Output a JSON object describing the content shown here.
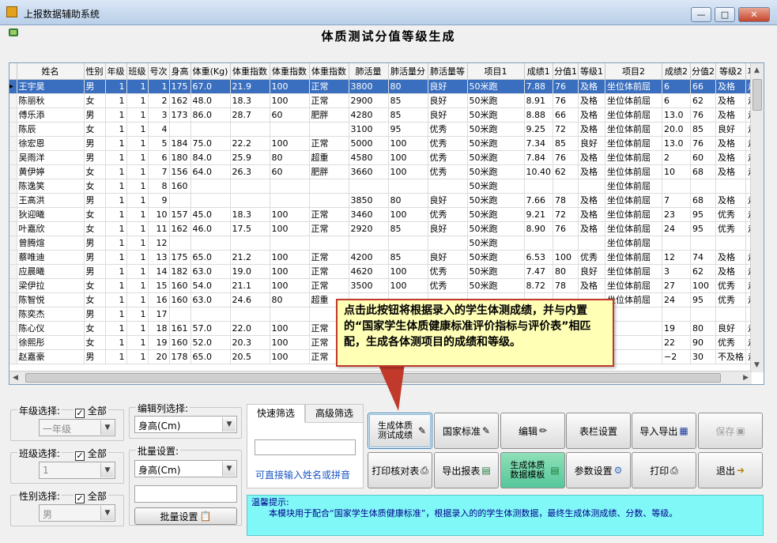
{
  "window": {
    "title": "上报数据辅助系统"
  },
  "window_buttons": {
    "minimize": "—",
    "maximize": "□",
    "close": "✕"
  },
  "heading": "体质测试分值等级生成",
  "columns": [
    "姓名",
    "性别",
    "年级",
    "班级",
    "号次",
    "身高",
    "体重(Kg)",
    "体重指数",
    "体重指数",
    "体重指数",
    "肺活量",
    "肺活量分",
    "肺活量等",
    "项目1",
    "成绩1",
    "分值1",
    "等级1",
    "项目2",
    "成绩2",
    "分值2",
    "等级2",
    "项"
  ],
  "rows": [
    [
      "王宇昊",
      "男",
      "1",
      "1",
      "1",
      "175",
      "67.0",
      "21.9",
      "100",
      "正常",
      "3800",
      "80",
      "良好",
      "50米跑",
      "7.88",
      "76",
      "及格",
      "坐位体前屈",
      "6",
      "66",
      "及格",
      "走"
    ],
    [
      "陈丽秋",
      "女",
      "1",
      "1",
      "2",
      "162",
      "48.0",
      "18.3",
      "100",
      "正常",
      "2900",
      "85",
      "良好",
      "50米跑",
      "8.91",
      "76",
      "及格",
      "坐位体前屈",
      "6",
      "62",
      "及格",
      "走"
    ],
    [
      "傅乐添",
      "男",
      "1",
      "1",
      "3",
      "173",
      "86.0",
      "28.7",
      "60",
      "肥胖",
      "4280",
      "85",
      "良好",
      "50米跑",
      "8.88",
      "66",
      "及格",
      "坐位体前屈",
      "13.0",
      "76",
      "及格",
      "走"
    ],
    [
      "陈辰",
      "女",
      "1",
      "1",
      "4",
      "",
      "",
      "",
      "",
      "",
      "3100",
      "95",
      "优秀",
      "50米跑",
      "9.25",
      "72",
      "及格",
      "坐位体前屈",
      "20.0",
      "85",
      "良好",
      "走"
    ],
    [
      "徐宏恩",
      "男",
      "1",
      "1",
      "5",
      "184",
      "75.0",
      "22.2",
      "100",
      "正常",
      "5000",
      "100",
      "优秀",
      "50米跑",
      "7.34",
      "85",
      "良好",
      "坐位体前屈",
      "13.0",
      "76",
      "及格",
      "走"
    ],
    [
      "吴雨洋",
      "男",
      "1",
      "1",
      "6",
      "180",
      "84.0",
      "25.9",
      "80",
      "超重",
      "4580",
      "100",
      "优秀",
      "50米跑",
      "7.84",
      "76",
      "及格",
      "坐位体前屈",
      "2",
      "60",
      "及格",
      "走"
    ],
    [
      "黄伊婷",
      "女",
      "1",
      "1",
      "7",
      "156",
      "64.0",
      "26.3",
      "60",
      "肥胖",
      "3660",
      "100",
      "优秀",
      "50米跑",
      "10.40",
      "62",
      "及格",
      "坐位体前屈",
      "10",
      "68",
      "及格",
      "走"
    ],
    [
      "陈逸笑",
      "女",
      "1",
      "1",
      "8",
      "160",
      "",
      "",
      "",
      "",
      "",
      "",
      "",
      "50米跑",
      "",
      "",
      "",
      "坐位体前屈",
      "",
      "",
      "",
      ""
    ],
    [
      "王高洪",
      "男",
      "1",
      "1",
      "9",
      "",
      "",
      "",
      "",
      "",
      "3850",
      "80",
      "良好",
      "50米跑",
      "7.66",
      "78",
      "及格",
      "坐位体前屈",
      "7",
      "68",
      "及格",
      "走"
    ],
    [
      "狄迎曦",
      "女",
      "1",
      "1",
      "10",
      "157",
      "45.0",
      "18.3",
      "100",
      "正常",
      "3460",
      "100",
      "优秀",
      "50米跑",
      "9.21",
      "72",
      "及格",
      "坐位体前屈",
      "23",
      "95",
      "优秀",
      "走"
    ],
    [
      "叶嘉欣",
      "女",
      "1",
      "1",
      "11",
      "162",
      "46.0",
      "17.5",
      "100",
      "正常",
      "2920",
      "85",
      "良好",
      "50米跑",
      "8.90",
      "76",
      "及格",
      "坐位体前屈",
      "24",
      "95",
      "优秀",
      "走"
    ],
    [
      "曾腾煊",
      "男",
      "1",
      "1",
      "12",
      "",
      "",
      "",
      "",
      "",
      "",
      "",
      "",
      "50米跑",
      "",
      "",
      "",
      "坐位体前屈",
      "",
      "",
      "",
      ""
    ],
    [
      "蔡唯迪",
      "男",
      "1",
      "1",
      "13",
      "175",
      "65.0",
      "21.2",
      "100",
      "正常",
      "4200",
      "85",
      "良好",
      "50米跑",
      "6.53",
      "100",
      "优秀",
      "坐位体前屈",
      "12",
      "74",
      "及格",
      "走"
    ],
    [
      "应晨曦",
      "男",
      "1",
      "1",
      "14",
      "182",
      "63.0",
      "19.0",
      "100",
      "正常",
      "4620",
      "100",
      "优秀",
      "50米跑",
      "7.47",
      "80",
      "良好",
      "坐位体前屈",
      "3",
      "62",
      "及格",
      "走"
    ],
    [
      "梁伊拉",
      "女",
      "1",
      "1",
      "15",
      "160",
      "54.0",
      "21.1",
      "100",
      "正常",
      "3500",
      "100",
      "优秀",
      "50米跑",
      "8.72",
      "78",
      "及格",
      "坐位体前屈",
      "27",
      "100",
      "优秀",
      "走"
    ],
    [
      "陈智悦",
      "女",
      "1",
      "1",
      "16",
      "160",
      "63.0",
      "24.6",
      "80",
      "超重",
      "",
      "",
      "",
      "",
      "",
      "",
      "",
      "坐位体前屈",
      "24",
      "95",
      "优秀",
      "走"
    ],
    [
      "陈奕杰",
      "男",
      "1",
      "1",
      "17",
      "",
      "",
      "",
      "",
      "",
      "",
      "",
      "",
      "",
      "",
      "",
      "",
      "",
      "",
      "",
      "",
      ""
    ],
    [
      "陈心仪",
      "女",
      "1",
      "1",
      "18",
      "161",
      "57.0",
      "22.0",
      "100",
      "正常",
      "",
      "",
      "",
      "",
      "",
      "",
      "",
      "",
      "19",
      "80",
      "良好",
      "走"
    ],
    [
      "徐熙彤",
      "女",
      "1",
      "1",
      "19",
      "160",
      "52.0",
      "20.3",
      "100",
      "正常",
      "",
      "",
      "",
      "",
      "",
      "",
      "",
      "",
      "22",
      "90",
      "优秀",
      "走"
    ],
    [
      "赵嘉豪",
      "男",
      "1",
      "1",
      "20",
      "178",
      "65.0",
      "20.5",
      "100",
      "正常",
      "",
      "",
      "",
      "",
      "",
      "",
      "",
      "",
      "−2",
      "30",
      "不及格",
      "走"
    ]
  ],
  "callout": "点击此按钮将根据录入的学生体测成绩，并与内置的“国家学生体质健康标准评价指标与评价表”相匹配，生成各体测项目的成绩和等级。",
  "filters": {
    "grade": {
      "label": "年级选择:",
      "all": "全部",
      "value": "一年级"
    },
    "class": {
      "label": "班级选择:",
      "all": "全部",
      "value": "1"
    },
    "gender": {
      "label": "性别选择:",
      "all": "全部",
      "value": "男"
    }
  },
  "edit_column": {
    "label": "编辑列选择:",
    "value": "身高(Cm)"
  },
  "batch": {
    "label": "批量设置:",
    "value": "身高(Cm)",
    "button": "批量设置"
  },
  "quick_filter": {
    "tab1": "快速筛选",
    "tab2": "高级筛选",
    "hint": "可直接输入姓名或拼音"
  },
  "buttons": {
    "generate": "生成体质测试成绩",
    "standard": "国家标准",
    "edit": "编辑",
    "columns": "表栏设置",
    "import_export": "导入导出",
    "save": "保存",
    "print_check": "打印核对表",
    "export_report": "导出报表",
    "gen_template": "生成体质数据模板",
    "params": "参数设置",
    "print": "打印",
    "exit": "退出"
  },
  "tip": {
    "title": "温馨提示:",
    "text": "本模块用于配合“国家学生体质健康标准”，根据录入的的学生体测数据，最终生成体测成绩、分数、等级。"
  }
}
